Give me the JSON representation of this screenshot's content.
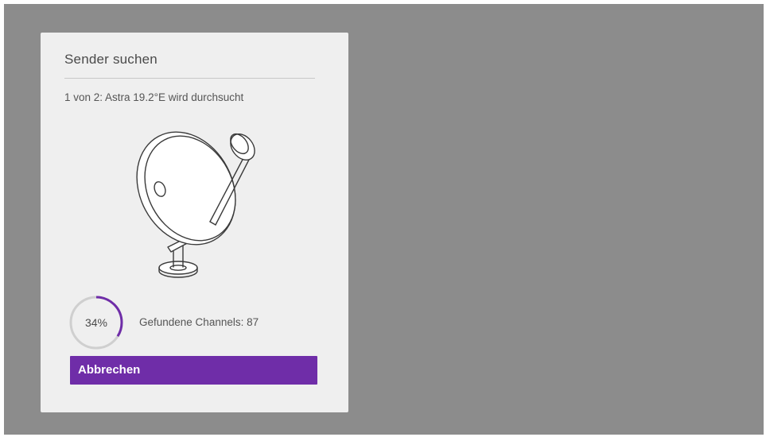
{
  "dialog": {
    "title": "Sender suchen",
    "status": "1 von 2: Astra 19.2°E wird durchsucht",
    "image": "satellite-dish-icon",
    "progress": {
      "value": 0.34,
      "label": "34%"
    },
    "found_channels": "Gefundene Channels: 87",
    "cancel_label": "Abbrechen"
  },
  "colors": {
    "background": "#8c8c8c",
    "dialog": "#efefef",
    "accent": "#6f2da8",
    "progress_track": "#cfcfcf"
  }
}
